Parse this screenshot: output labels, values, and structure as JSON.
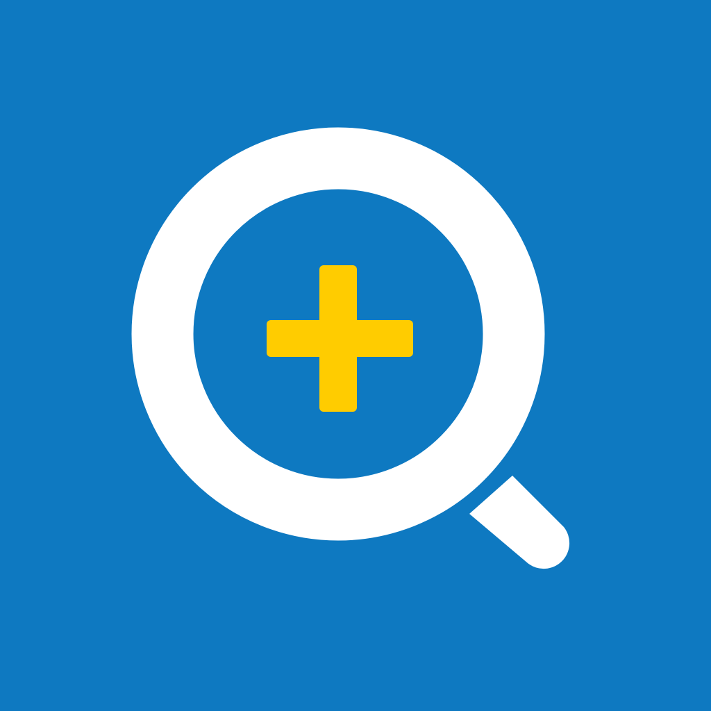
{
  "icon": {
    "name": "zoom-in-icon",
    "colors": {
      "background": "#0E79C1",
      "magnifier": "#FFFFFF",
      "plus": "#FFCC00"
    }
  }
}
